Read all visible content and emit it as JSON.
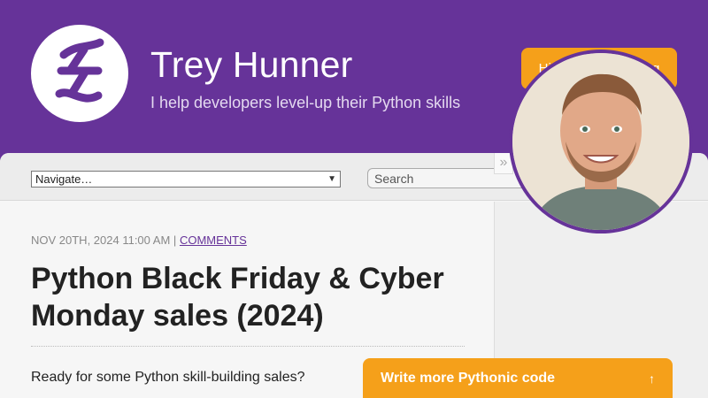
{
  "header": {
    "title": "Trey Hunner",
    "subtitle": "I help developers level-up their Python skills",
    "hire_button": "Hire Me For Training",
    "logo_icon": "th-monogram-icon"
  },
  "navbar": {
    "navigate_value": "Navigate…",
    "search_placeholder": "Search"
  },
  "post": {
    "date": "NOV 20TH, 2024 11:00 AM",
    "separator": "|",
    "comments_link": "COMMENTS",
    "title": "Python Black Friday & Cyber Monday sales (2024)",
    "intro": "Ready for some Python skill-building sales?"
  },
  "sidebar": {
    "collapse_glyph": "»",
    "avatar_icon": "author-photo"
  },
  "cta": {
    "label": "Write more Pythonic code",
    "arrow": "↑"
  },
  "colors": {
    "brand_purple": "#663399",
    "accent_orange": "#f5a01a"
  }
}
